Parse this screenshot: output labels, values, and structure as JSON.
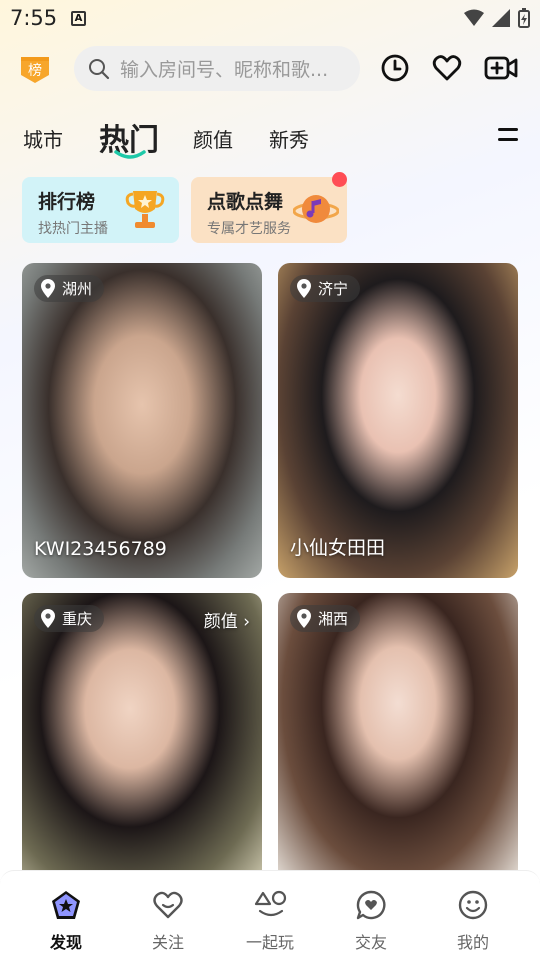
{
  "status_bar": {
    "time": "7:55",
    "notification_glyph": "A"
  },
  "header": {
    "rank_badge": "榜",
    "search_placeholder": "输入房间号、昵称和歌...",
    "icons": [
      "history-icon",
      "heart-icon",
      "video-add-icon"
    ]
  },
  "tabs": [
    {
      "label": "城市",
      "active": false
    },
    {
      "label": "热门",
      "active": true
    },
    {
      "label": "颜值",
      "active": false
    },
    {
      "label": "新秀",
      "active": false
    }
  ],
  "promos": [
    {
      "title": "排行榜",
      "subtitle": "找热门主播"
    },
    {
      "title": "点歌点舞",
      "subtitle": "专属才艺服务"
    }
  ],
  "cards": [
    {
      "location": "湖州",
      "name": "KWI23456789",
      "tag": ""
    },
    {
      "location": "济宁",
      "name": "小仙女田田",
      "tag": ""
    },
    {
      "location": "重庆",
      "name": "",
      "tag": "颜值 ›"
    },
    {
      "location": "湘西",
      "name": "",
      "tag": ""
    }
  ],
  "bottom_nav": [
    {
      "label": "发现",
      "active": true
    },
    {
      "label": "关注",
      "active": false
    },
    {
      "label": "一起玩",
      "active": false
    },
    {
      "label": "交友",
      "active": false
    },
    {
      "label": "我的",
      "active": false
    }
  ],
  "colors": {
    "accent": "#1ec9a8",
    "badge_orange": "#f7a62b",
    "red_dot": "#ff4d55"
  }
}
